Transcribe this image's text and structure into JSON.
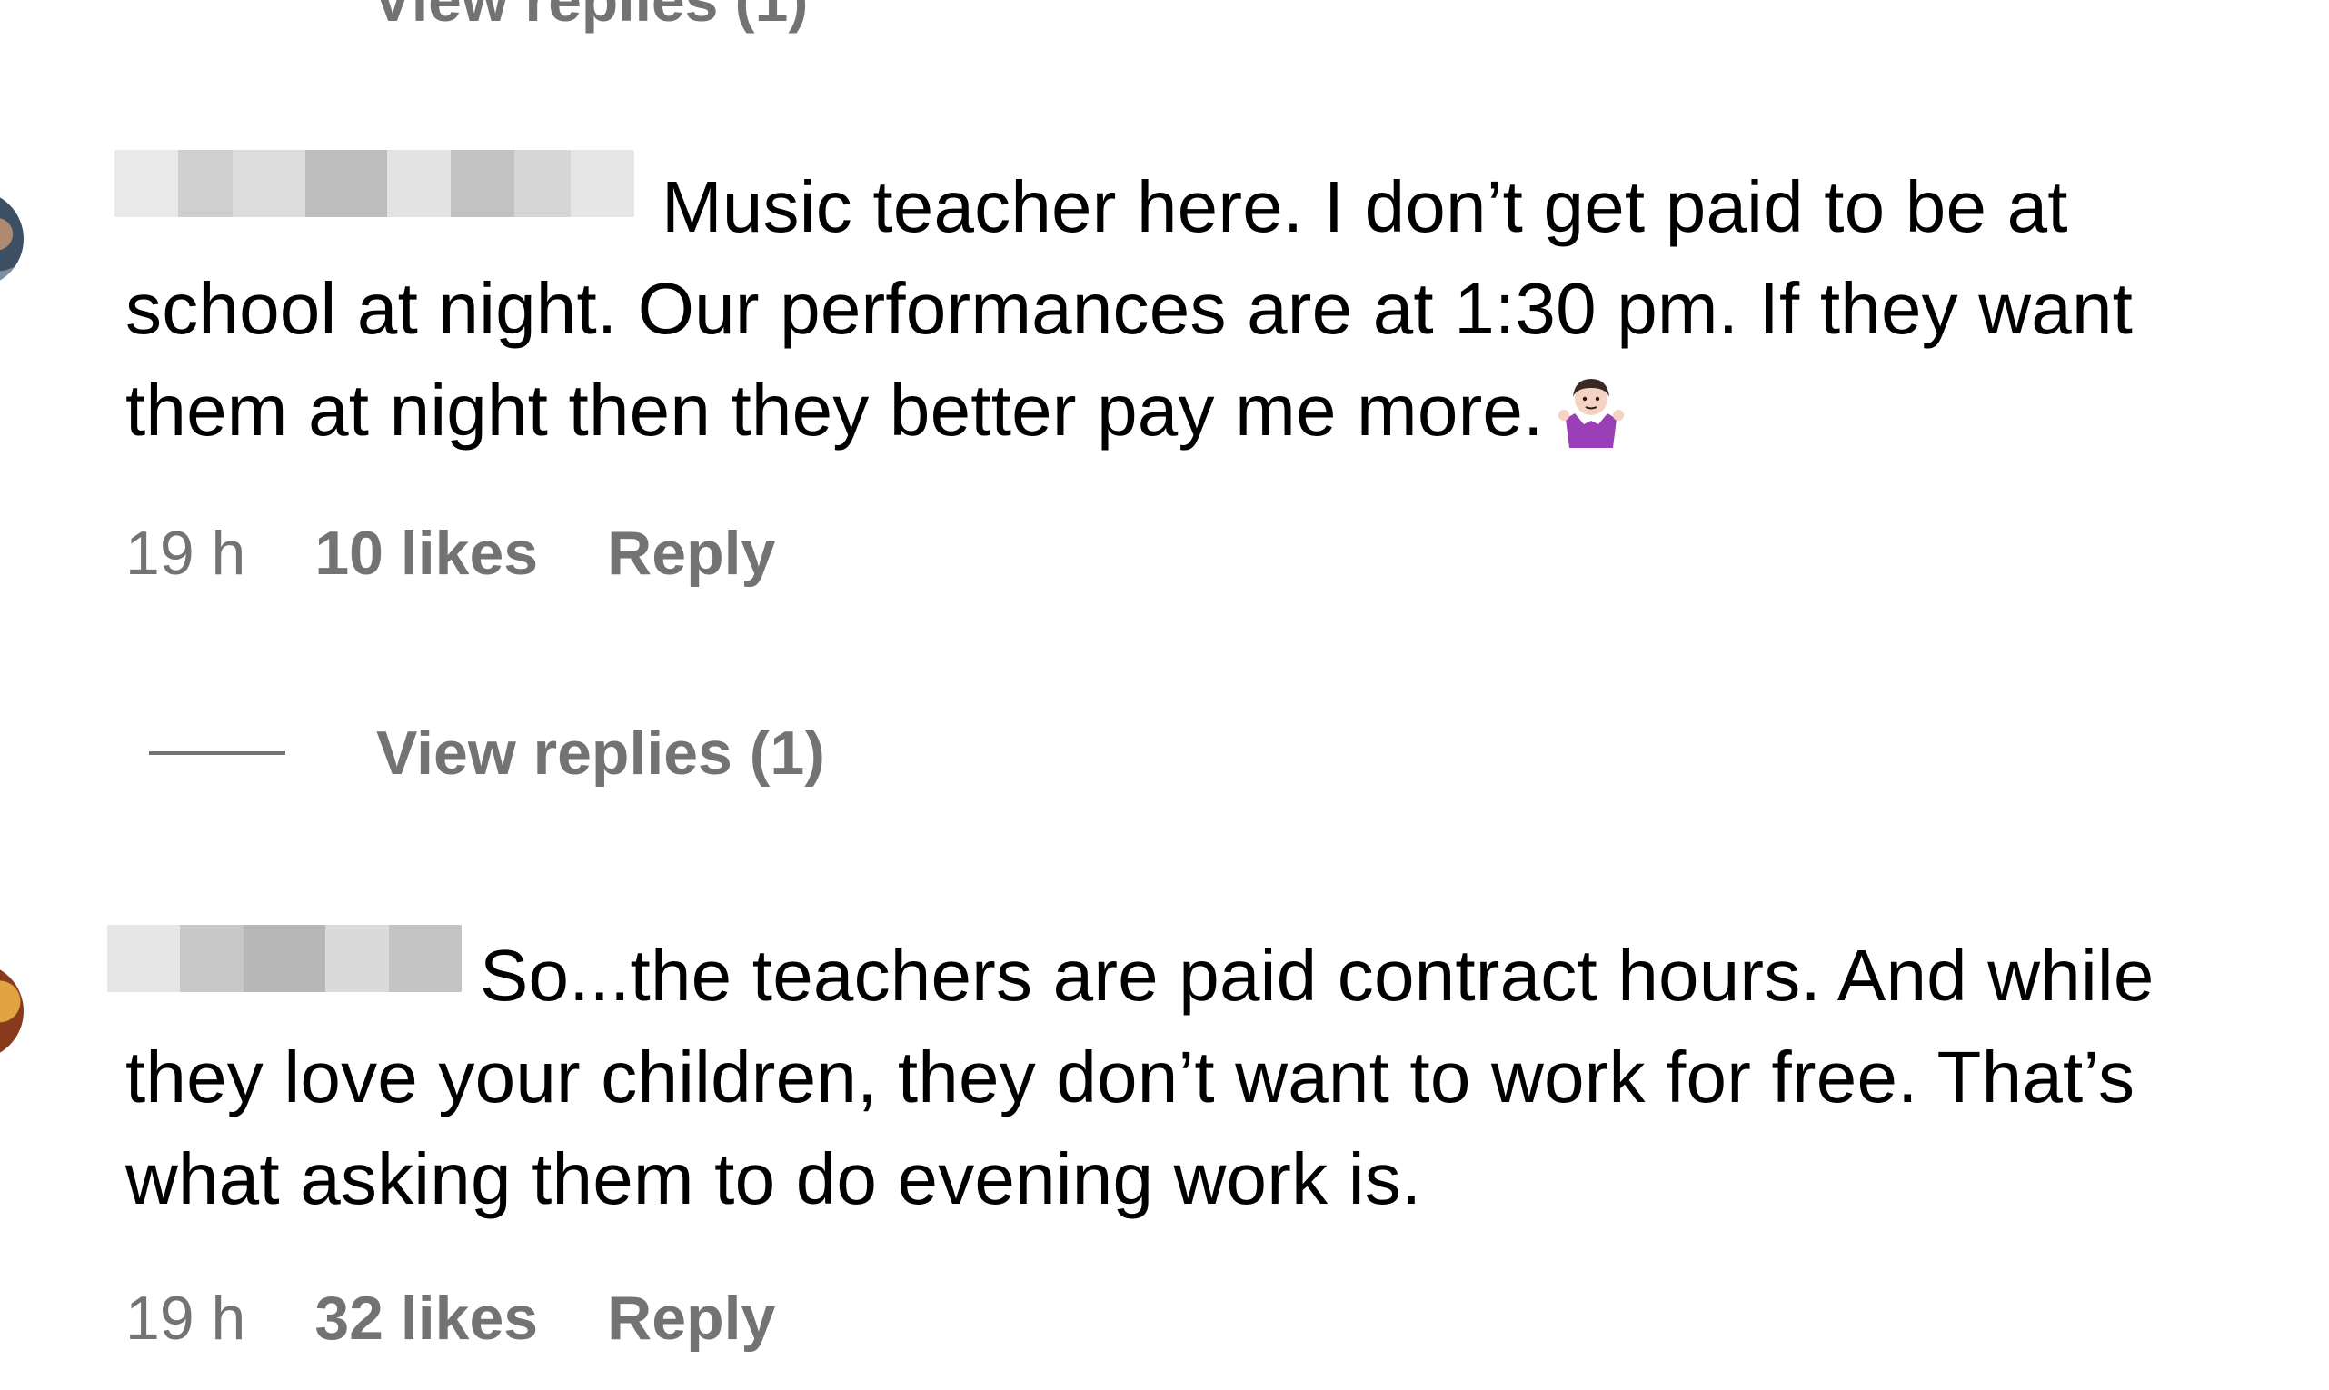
{
  "top_link": {
    "label": "View replies (1)"
  },
  "comments": [
    {
      "text": "Music teacher here. I don’t get paid to be at school at night. Our performances are at 1:30 pm. If they want them at night then they better pay me more.",
      "emoji": "woman-shrugging-emoji",
      "time": "19 h",
      "likes": "10 likes",
      "reply_label": "Reply",
      "view_replies": "View replies (1)"
    },
    {
      "text": "So...the teachers are paid contract hours. And while they love your children, they don’t want to work for free. That’s what asking them to do evening work is.",
      "time": "19 h",
      "likes": "32 likes",
      "reply_label": "Reply"
    }
  ],
  "colors": {
    "text": "#000000",
    "secondary": "#737373",
    "background": "#ffffff"
  }
}
